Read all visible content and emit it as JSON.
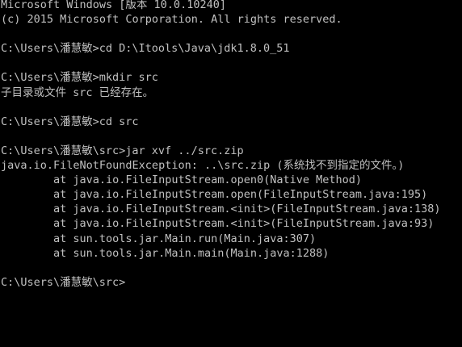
{
  "window": {
    "lines": [
      "Microsoft Windows [版本 10.0.10240]",
      "(c) 2015 Microsoft Corporation. All rights reserved.",
      "",
      "C:\\Users\\潘慧敏>cd D:\\Itools\\Java\\jdk1.8.0_51",
      "",
      "C:\\Users\\潘慧敏>mkdir src",
      "子目录或文件 src 已经存在。",
      "",
      "C:\\Users\\潘慧敏>cd src",
      "",
      "C:\\Users\\潘慧敏\\src>jar xvf ../src.zip",
      "java.io.FileNotFoundException: ..\\src.zip (系统找不到指定的文件。)",
      "        at java.io.FileInputStream.open0(Native Method)",
      "        at java.io.FileInputStream.open(FileInputStream.java:195)",
      "        at java.io.FileInputStream.<init>(FileInputStream.java:138)",
      "        at java.io.FileInputStream.<init>(FileInputStream.java:93)",
      "        at sun.tools.jar.Main.run(Main.java:307)",
      "        at sun.tools.jar.Main.main(Main.java:1288)",
      "",
      "C:\\Users\\潘慧敏\\src>"
    ]
  },
  "colors": {
    "background": "#000000",
    "foreground": "#c0c0c0"
  }
}
